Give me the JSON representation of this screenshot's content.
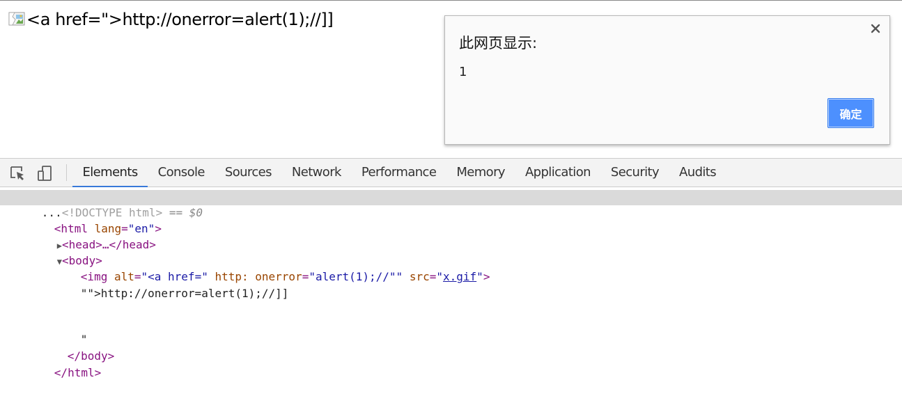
{
  "page": {
    "text": "<a href=\">http://onerror=alert(1);//]]"
  },
  "dialog": {
    "title": "此网页显示:",
    "message": "1",
    "ok_label": "确定"
  },
  "devtools": {
    "tabs": [
      "Elements",
      "Console",
      "Sources",
      "Network",
      "Performance",
      "Memory",
      "Application",
      "Security",
      "Audits"
    ],
    "active_tab": "Elements",
    "tree": {
      "doctype_dots": "...",
      "doctype": "<!DOCTYPE html>",
      "selected_marker": " == $0",
      "html_open_tag": "<html",
      "html_lang_attr": " lang",
      "html_lang_eq": "=",
      "html_lang_value": "\"en\"",
      "html_open_close": ">",
      "head_collapsed": "<head>…</head>",
      "body_open": "<body>",
      "img_open": "<img",
      "img_alt_attr": " alt",
      "img_alt_eq": "=",
      "img_alt_value": "\"<a href=\"",
      "img_http_attr": " http:",
      "img_onerror_attr": " onerror",
      "img_onerror_eq": "=",
      "img_onerror_value": "\"alert(1);//\"\"",
      "img_src_attr": " src",
      "img_src_eq": "=",
      "img_src_q1": "\"",
      "img_src_value": "x.gif",
      "img_src_q2": "\"",
      "img_close": ">",
      "text_node_1": "\"\">http://onerror=alert(1);//]]",
      "text_node_2": "\"",
      "body_close": "</body>",
      "html_close": "</html>"
    }
  }
}
